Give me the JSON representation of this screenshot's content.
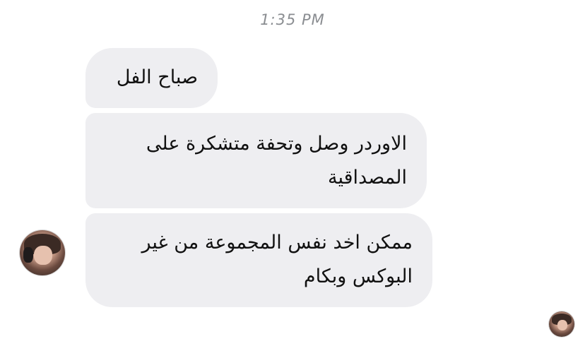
{
  "conversation": {
    "timestamp": "1:35 PM",
    "messages": [
      {
        "text": "صباح الفل"
      },
      {
        "text": "الاوردر وصل وتحفة متشكرة على المصداقية"
      },
      {
        "text": "ممكن اخد نفس المجموعة من غير البوكس وبكام"
      }
    ]
  },
  "colors": {
    "incoming_bubble": "#eeeef1",
    "timestamp_text": "#8a8d91",
    "message_text": "#111111"
  },
  "icons": {
    "sender_avatar": "user-avatar-icon",
    "read_receipt": "seen-avatar-icon"
  }
}
